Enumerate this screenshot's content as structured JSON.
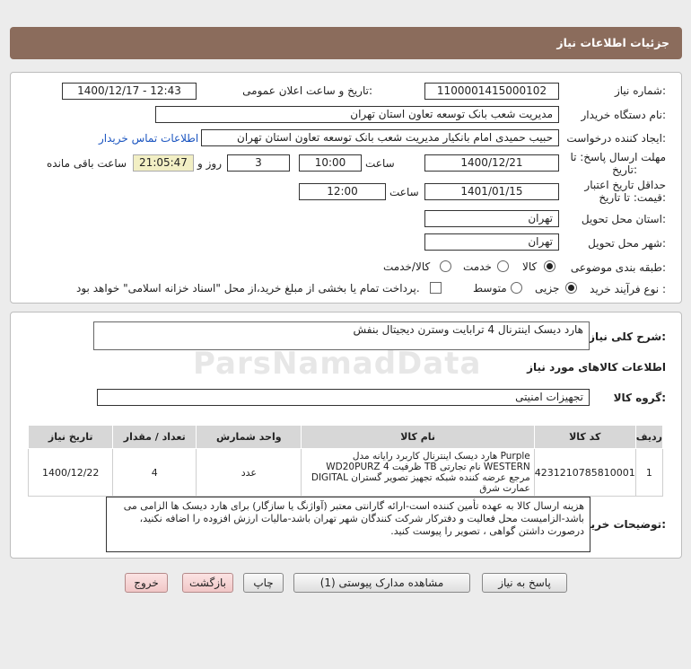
{
  "header": {
    "title": "جزئیات اطلاعات نیاز"
  },
  "info": {
    "need_number_label": "شماره نیاز:",
    "need_number": "1100001415000102",
    "announce_label": "تاریخ و ساعت اعلان عمومی:",
    "announce_value": "1400/12/17 - 12:43",
    "buyer_org_label": "نام دستگاه خریدار:",
    "buyer_org": "مدیریت شعب بانک توسعه تعاون استان تهران",
    "creator_label": "ایجاد کننده درخواست:",
    "creator": "حبیب حمیدی امام بانکیار مدیریت شعب بانک توسعه تعاون استان تهران",
    "contact_link": "اطلاعات تماس خریدار",
    "reply_deadline_label_1": "مهلت ارسال پاسخ: تا",
    "reply_deadline_label_2": "تاریخ:",
    "reply_date": "1400/12/21",
    "time_label": "ساعت",
    "reply_time": "10:00",
    "days_value": "3",
    "days_label": "روز و",
    "remaining_time": "21:05:47",
    "remaining_label": "ساعت باقی مانده",
    "validity_label_1": "حداقل تاریخ اعتبار",
    "validity_label_2": "قیمت: تا تاریخ:",
    "validity_date": "1401/01/15",
    "validity_time": "12:00",
    "province_label": "استان محل تحویل:",
    "province": "تهران",
    "city_label": "شهر محل تحویل:",
    "city": "تهران",
    "category_label": "طبقه بندی موضوعی:",
    "category_options": [
      "کالا",
      "خدمت",
      "کالا/خدمت"
    ],
    "process_label": "نوع فرآیند خرید :",
    "process_options": [
      "جزیی",
      "متوسط"
    ],
    "treasury_note": "پرداخت تمام یا بخشی از مبلغ خرید،از محل \"اسناد خزانه اسلامی\" خواهد بود."
  },
  "needs": {
    "summary_label": "شرح کلی نیاز:",
    "summary": "هارد دیسک اینترنال 4 ترابایت وسترن دیجیتال بنفش",
    "goods_info_title": "اطلاعات کالاهای مورد نیاز",
    "group_label": "گروه کالا:",
    "group": "تجهیزات امنیتی",
    "columns": [
      "ردیف",
      "کد کالا",
      "نام کالا",
      "واحد شمارش",
      "تعداد / مقدار",
      "تاریخ نیاز"
    ],
    "rows": [
      {
        "index": "1",
        "code": "4231210785810001",
        "name": "هارد دیسک اینترنال کاربرد رایانه مدل Purple WD20PURZ ظرفیت 4 TB نام تجارتی WESTERN DIGITAL مرجع عرضه کننده شبکه تجهیز تصویر گستران عمارت شرق",
        "unit": "عدد",
        "qty": "4",
        "date": "1400/12/22"
      }
    ],
    "buyer_notes_label": "توضیحات خریدار:",
    "buyer_notes": "هزینه ارسال کالا به عهده تأمین کننده است-ارائه گارانتی معتبر (آواژنگ یا سازگار) برای هارد دیسک ها الزامی می باشد-الزامیست محل فعالیت و دفترکار شرکت کنندگان شهر تهران باشد-مالیات ارزش افزوده را اضافه نکنید، درصورت داشتن گواهی ، تصویر را پیوست کنید."
  },
  "buttons": {
    "reply": "پاسخ به نیاز",
    "attachments": "مشاهده مدارک پیوستی (1)",
    "print": "چاپ",
    "back": "بازگشت",
    "exit": "خروج"
  },
  "watermark": "ParsNamadData"
}
